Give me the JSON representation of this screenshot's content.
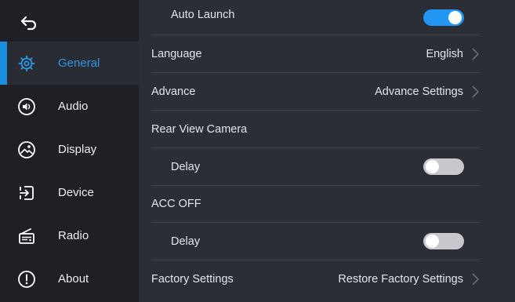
{
  "sidebar": {
    "items": [
      {
        "label": "General",
        "icon": "gear-icon",
        "active": true
      },
      {
        "label": "Audio",
        "icon": "speaker-icon",
        "active": false
      },
      {
        "label": "Display",
        "icon": "display-brightness-icon",
        "active": false
      },
      {
        "label": "Device",
        "icon": "device-input-icon",
        "active": false
      },
      {
        "label": "Radio",
        "icon": "radio-icon",
        "active": false
      },
      {
        "label": "About",
        "icon": "info-icon",
        "active": false
      }
    ]
  },
  "settings": {
    "auto_launch": {
      "label": "Auto Launch",
      "on": true
    },
    "language": {
      "label": "Language",
      "value": "English"
    },
    "advance": {
      "label": "Advance",
      "value": "Advance Settings"
    },
    "rear_view_camera": {
      "label": "Rear View Camera"
    },
    "rear_delay": {
      "label": "Delay",
      "on": false
    },
    "acc_off": {
      "label": "ACC OFF"
    },
    "acc_delay": {
      "label": "Delay",
      "on": false
    },
    "factory": {
      "label": "Factory Settings",
      "value": "Restore Factory Settings"
    }
  },
  "colors": {
    "accent": "#2196f3",
    "active_text": "#2b98e4",
    "sidebar_bg": "#1f2025",
    "content_bg": "#2c2e36"
  }
}
